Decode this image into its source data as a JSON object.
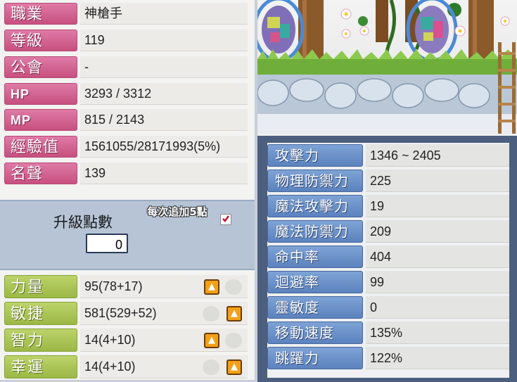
{
  "info_rows": [
    {
      "label": "職業",
      "value": "神槍手"
    },
    {
      "label": "等級",
      "value": "119"
    },
    {
      "label": "公會",
      "value": "-"
    },
    {
      "label": "HP",
      "value": "3293 / 3312"
    },
    {
      "label": "MP",
      "value": "815 / 2143"
    },
    {
      "label": "經驗值",
      "value": "1561055/28171993(5%)"
    },
    {
      "label": "名聲",
      "value": "139"
    }
  ],
  "points": {
    "title": "升級點數",
    "value": "0",
    "add5_label": "每次追加5點",
    "add5_checked": true
  },
  "stats": [
    {
      "label": "力量",
      "value": "95(78+17)"
    },
    {
      "label": "敏捷",
      "value": "581(529+52)"
    },
    {
      "label": "智力",
      "value": "14(4+10)"
    },
    {
      "label": "幸運",
      "value": "14(4+10)"
    }
  ],
  "attributes": [
    {
      "label": "攻擊力",
      "value": "1346 ~ 2405"
    },
    {
      "label": "物理防禦力",
      "value": "225"
    },
    {
      "label": "魔法攻擊力",
      "value": "19"
    },
    {
      "label": "魔法防禦力",
      "value": "209"
    },
    {
      "label": "命中率",
      "value": "404"
    },
    {
      "label": "迴避率",
      "value": "99"
    },
    {
      "label": "靈敏度",
      "value": "0"
    },
    {
      "label": "移動速度",
      "value": "135%"
    },
    {
      "label": "跳躍力",
      "value": "122%"
    }
  ],
  "colors": {
    "info_label": "#d3628f",
    "stat_label": "#adc557",
    "attr_label": "#6d93ca",
    "up_button": "#f4a017"
  }
}
